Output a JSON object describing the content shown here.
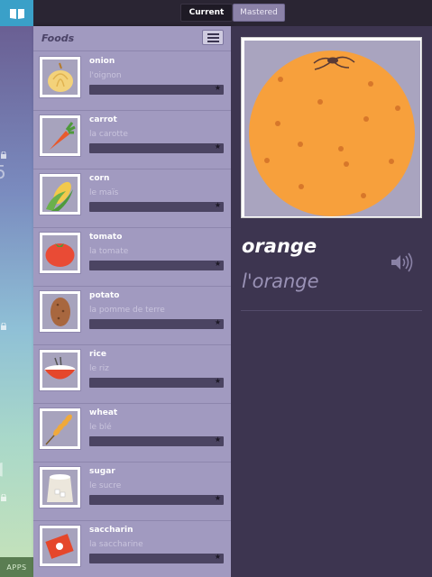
{
  "toolbar": {
    "segments": {
      "current": "Current",
      "mastered": "Mastered"
    },
    "selected_segment": "Current"
  },
  "side_strip": {
    "apps_label": "APPS"
  },
  "list": {
    "title": "Foods",
    "items": [
      {
        "word": "onion",
        "translation": "l'oignon",
        "icon": "onion-icon",
        "starred": true
      },
      {
        "word": "carrot",
        "translation": "la carotte",
        "icon": "carrot-icon",
        "starred": true
      },
      {
        "word": "corn",
        "translation": "le maïs",
        "icon": "corn-icon",
        "starred": true
      },
      {
        "word": "tomato",
        "translation": "la tomate",
        "icon": "tomato-icon",
        "starred": true
      },
      {
        "word": "potato",
        "translation": "la pomme de terre",
        "icon": "potato-icon",
        "starred": true
      },
      {
        "word": "rice",
        "translation": "le riz",
        "icon": "rice-icon",
        "starred": true
      },
      {
        "word": "wheat",
        "translation": "le blé",
        "icon": "wheat-icon",
        "starred": true
      },
      {
        "word": "sugar",
        "translation": "le sucre",
        "icon": "sugar-icon",
        "starred": true
      },
      {
        "word": "saccharin",
        "translation": "la saccharine",
        "icon": "saccharin-icon",
        "starred": true
      }
    ]
  },
  "detail": {
    "word": "orange",
    "translation": "l'orange",
    "image_icon": "orange-icon",
    "audio_icon": "speaker-icon"
  },
  "colors": {
    "accent": "#3aa0c8",
    "panel": "#a19ac0",
    "background": "#3d3550",
    "orange": "#f7a03c"
  }
}
